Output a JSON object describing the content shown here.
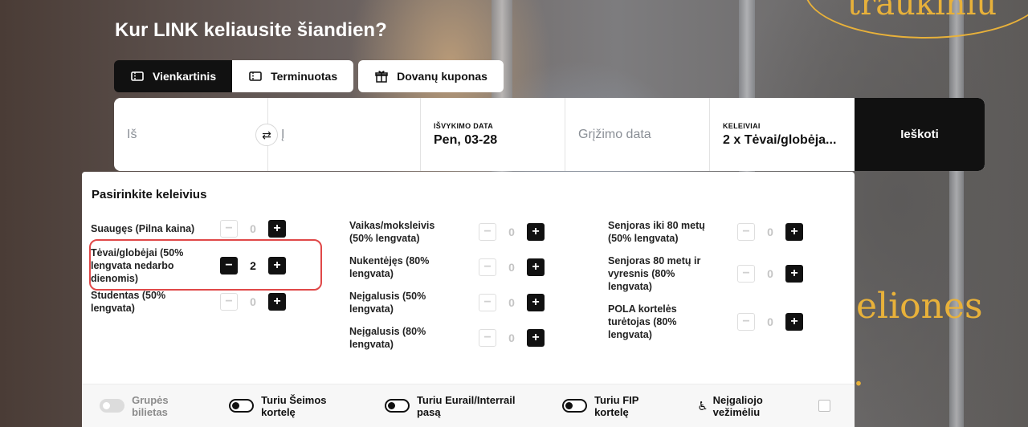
{
  "heading": "Kur LINK keliausite šiandien?",
  "tabs": [
    {
      "label": "Vienkartinis",
      "icon": "ticket-icon"
    },
    {
      "label": "Terminuotas",
      "icon": "ticket-icon"
    },
    {
      "label": "Dovanų kuponas",
      "icon": "gift-icon"
    }
  ],
  "search": {
    "from_placeholder": "Iš",
    "to_placeholder": "Į",
    "departure_label": "IŠVYKIMO DATA",
    "departure_value": "Pen, 03-28",
    "return_placeholder": "Grįžimo data",
    "passengers_label": "KELEIVIAI",
    "passengers_value": "2 x Tėvai/globėja...",
    "search_button": "Ieškoti"
  },
  "panel": {
    "title": "Pasirinkite keleivius",
    "columns": [
      [
        {
          "label": "Suaugęs (Pilna kaina)",
          "count": "0"
        },
        {
          "label": "Tėvai/globėjai (50% lengvata nedarbo dienomis)",
          "count": "2"
        },
        {
          "label": "Studentas (50% lengvata)",
          "count": "0"
        }
      ],
      [
        {
          "label": "Vaikas/moksleivis (50% lengvata)",
          "count": "0"
        },
        {
          "label": "Nukentėjęs (80% lengvata)",
          "count": "0"
        },
        {
          "label": "Neįgalusis (50% lengvata)",
          "count": "0"
        },
        {
          "label": "Neįgalusis (80% lengvata)",
          "count": "0"
        }
      ],
      [
        {
          "label": "Senjoras iki 80 metų (50% lengvata)",
          "count": "0"
        },
        {
          "label": "Senjoras 80 metų ir vyresnis (80% lengvata)",
          "count": "0"
        },
        {
          "label": "POLA kortelės turėtojas (80% lengvata)",
          "count": "0"
        }
      ]
    ]
  },
  "footer": {
    "group_ticket": "Grupės bilietas",
    "family_card": "Turiu Šeimos kortelę",
    "eurail_pass": "Turiu Eurail/Interrail pasą",
    "fip_card": "Turiu FIP kortelę",
    "wheelchair": "Neįgaliojo vežimėliu"
  },
  "deco": {
    "top": "traukiniu",
    "mid": "eliones",
    "dot": "."
  },
  "colors": {
    "accent": "#e8b13a",
    "highlight": "#e04848",
    "dark": "#111111"
  }
}
